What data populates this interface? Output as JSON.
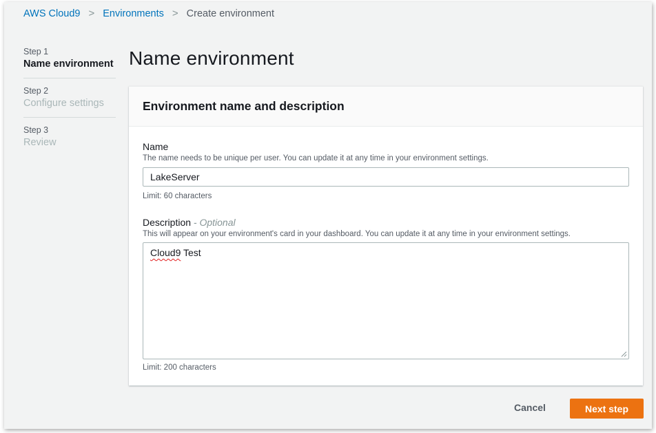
{
  "breadcrumb": {
    "items": [
      "AWS Cloud9",
      "Environments",
      "Create environment"
    ],
    "separator": ">"
  },
  "steps": [
    {
      "number": "Step 1",
      "label": "Name environment",
      "active": true
    },
    {
      "number": "Step 2",
      "label": "Configure settings",
      "active": false
    },
    {
      "number": "Step 3",
      "label": "Review",
      "active": false
    }
  ],
  "page_title": "Name environment",
  "card": {
    "title": "Environment name and description",
    "name_field": {
      "label": "Name",
      "hint": "The name needs to be unique per user. You can update it at any time in your environment settings.",
      "value": "LakeServer",
      "limit": "Limit: 60 characters"
    },
    "description_field": {
      "label": "Description",
      "optional": "- Optional",
      "hint": "This will appear on your environment's card in your dashboard. You can update it at any time in your environment settings.",
      "value_word1": "Cloud9",
      "value_word2": " Test",
      "limit": "Limit: 200 characters"
    }
  },
  "actions": {
    "cancel_label": "Cancel",
    "next_label": "Next step"
  },
  "colors": {
    "link": "#0073bb",
    "primary_button": "#ec7211",
    "background": "#f2f3f3"
  },
  "icons": {
    "breadcrumb_separator": "chevron-right-icon",
    "resize_handle": "resize-grip-icon"
  }
}
